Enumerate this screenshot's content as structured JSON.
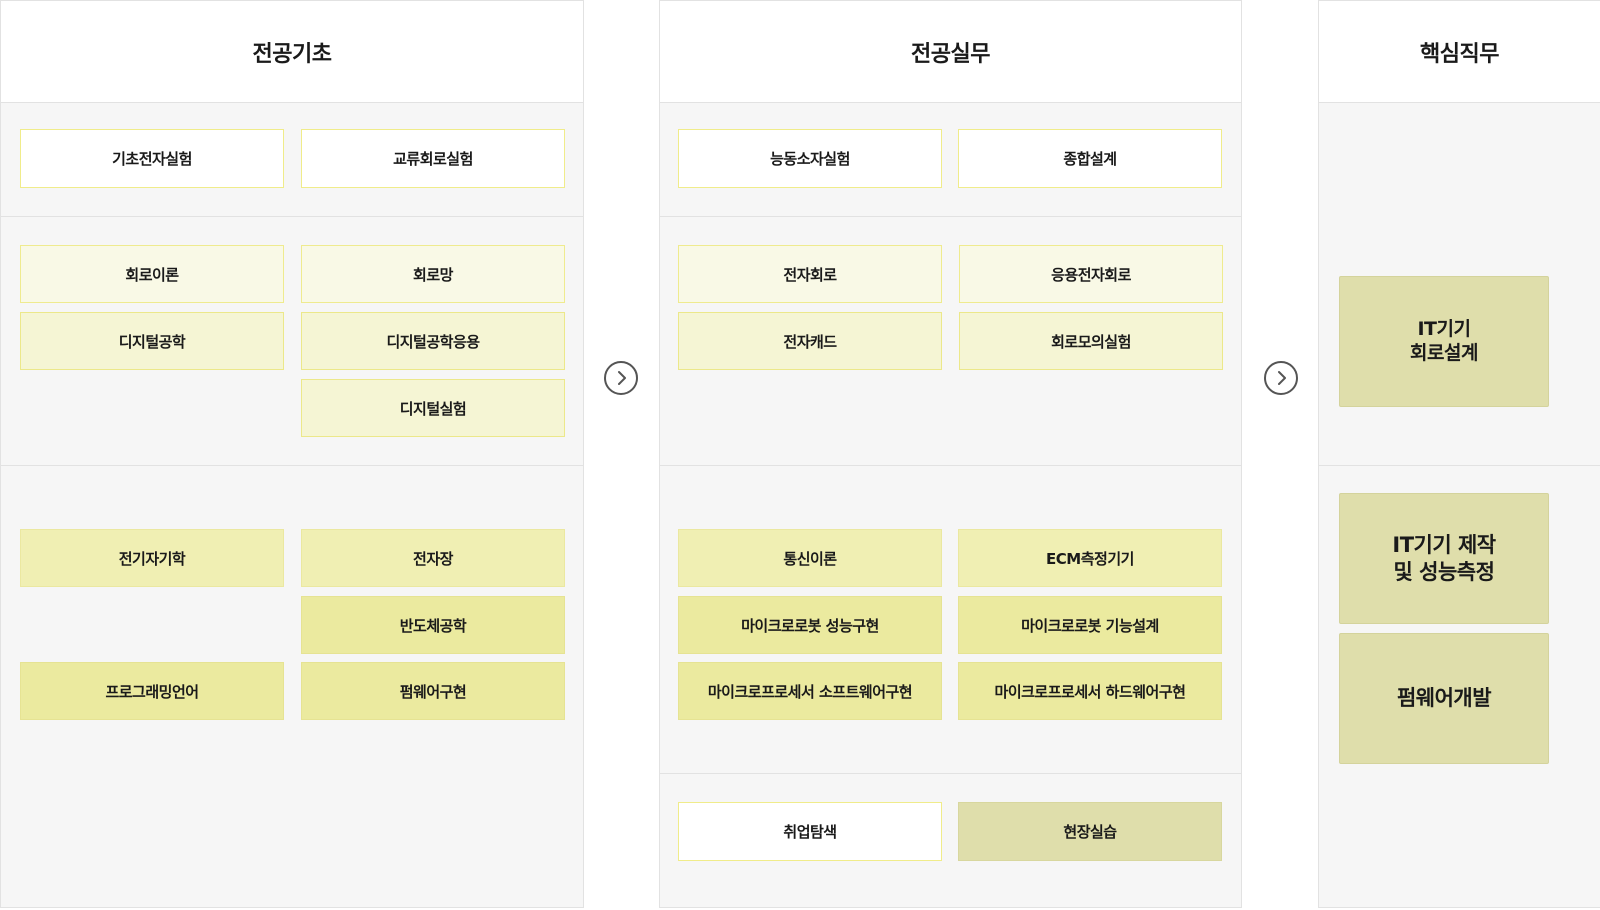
{
  "columns": {
    "foundation": {
      "title": "전공기초",
      "row1": [
        "기초전자실험",
        "교류회로실험"
      ],
      "row2": [
        "회로이론",
        "회로망",
        "디지털공학",
        "디지털공학응용",
        "디지털실험"
      ],
      "row3": [
        "전기자기학",
        "전자장",
        "반도체공학",
        "프로그래밍언어",
        "펌웨어구현"
      ]
    },
    "practice": {
      "title": "전공실무",
      "row1": [
        "능동소자실험",
        "종합설계"
      ],
      "row2": [
        "전자회로",
        "응용전자회로",
        "전자캐드",
        "회로모의실험"
      ],
      "row3": [
        "통신이론",
        "ECM측정기기",
        "마이크로로봇 성능구현",
        "마이크로로봇 기능설계",
        "마이크로프로세서 소프트웨어구현",
        "마이크로프로세서 하드웨어구현"
      ],
      "row4": [
        "취업탐색",
        "현장실습"
      ]
    },
    "core_jobs": {
      "title": "핵심직무",
      "items": [
        "IT기기\n회로설계",
        "IT기기 제작\n및 성능측정",
        "펌웨어개발"
      ]
    }
  },
  "icons": {
    "arrow1": "chevron-right-circle-icon",
    "arrow2": "chevron-right-circle-icon"
  },
  "colors": {
    "white_box": "#ffffff",
    "light_1": "#f9f9e6",
    "light_2": "#f5f5d4",
    "mid_1": "#f0efb3",
    "mid_2": "#ebea9f",
    "khaki": "#dfdeab",
    "panel_bg": "#f6f6f6",
    "border": "#e2e2e2"
  }
}
